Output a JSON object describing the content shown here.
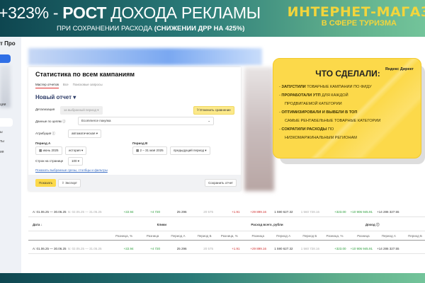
{
  "header": {
    "headline_prefix": "+323% - ",
    "headline_bold": "РОСТ",
    "headline_rest": " ДОХОДА РЕКЛАМЫ",
    "sub_prefix": "ПРИ СОХРАНЕНИИ РАСХОДА ",
    "sub_bold": "(СНИЖЕНИИ ДРР НА 425%)",
    "brand": "ИНТЕРНЕТ-МАГАЗ",
    "brand_sub": "В СФЕРЕ ТУРИЗМА"
  },
  "sidebar": {
    "logo": "т Про",
    "items": [
      "ции",
      "ы",
      "ты",
      "ия"
    ]
  },
  "panel": {
    "title": "Статистика по всем кампаниям",
    "tabs": [
      "Мастер отчетов",
      "Все",
      "Поисковые запросы"
    ],
    "report": "Новый отчет ▾",
    "detail_label": "Детализация",
    "detail_value": "за выбранный период ▾",
    "cancel_compare": "⅟ Отменить сравнение",
    "goals_label": "Данные по целям ⓘ",
    "goals_value": "Ecommerce покупка",
    "attr_label": "Атрибуция ⓘ",
    "attr_value": "автоматическая ▾",
    "period_a": "Период А",
    "period_a_value": "июнь 2025",
    "period_a_mode": "история ▾",
    "period_b": "Период B",
    "period_b_value": "2 – 31 мая 2025",
    "period_b_mode": "предыдущий период ▾",
    "rows_label": "Строк на странице",
    "rows_value": "100 ▾",
    "show_link": "Показать выбранные срезы, столбцы и фильтры",
    "show_btn": "Показать",
    "export_btn": "Экспорт",
    "save_btn": "Сохранить отчет"
  },
  "card": {
    "title": "ЧТО СДЕЛАЛИ:",
    "logo": "Яндекс Директ",
    "items": [
      {
        "b": "ЗАПУСТИЛИ",
        "t": " ТОВАРНЫЕ КАМПАНИИ ПО ФИДУ"
      },
      {
        "b": "ПРОРАБОТАЛИ УТП",
        "t": " ДЛЯ КАЖДОЙ"
      },
      {
        "b": "",
        "t": "ПРОДВИГАЕМОЙ КАТЕГОРИИ",
        "cont": true
      },
      {
        "b": "ОПТИМИЗИРОВАЛИ И ВЫВЕЛИ В ТОП",
        "t": ""
      },
      {
        "b": "",
        "t": "САМЫЕ РЕНТАБЕЛЬНЫЕ ТОВАРНЫЕ КАТЕГОРИИ",
        "cont": true
      },
      {
        "b": "СОКРАТИЛИ РАСХОДЫ",
        "t": " ПО"
      },
      {
        "b": "",
        "t": "НИЗКОМАРЖИНАЛЬНЫМ РЕГИОНАМ",
        "cont": true
      }
    ]
  },
  "table": {
    "date_a": "А: 01.06.25 — 30.06.25",
    "date_b": "Б: 02.05.25 — 31.05.25",
    "date_header": "Дата ↓",
    "groups": [
      "Клики",
      "Расход всего, рубли",
      "Доход ⓘ"
    ],
    "subs": [
      "Разница, %",
      "Разница",
      "Период А",
      "Период Б"
    ],
    "values": [
      "+22.94",
      "+4 720",
      "25 296",
      "20 575",
      "+1.91",
      "+29 899.16",
      "1 590 627.32",
      "1 560 728.16",
      "+323.00",
      "+10 906 945.91",
      "+14 286 327.55"
    ],
    "classes": [
      "g",
      "g",
      "",
      "gr",
      "r",
      "r",
      "",
      "gr",
      "g",
      "g",
      ""
    ]
  }
}
